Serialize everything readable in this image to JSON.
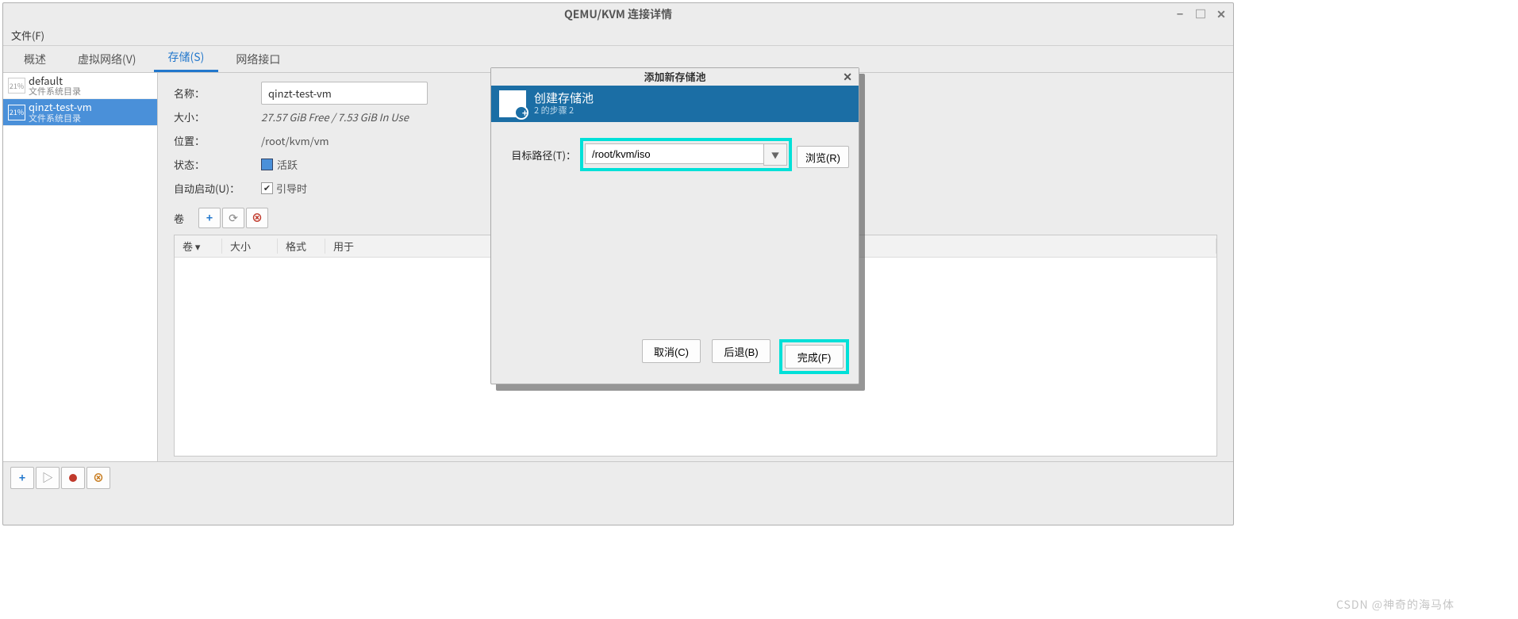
{
  "window": {
    "title": "QEMU/KVM 连接详情",
    "min": "−",
    "max": "□",
    "close": "✕"
  },
  "menubar": {
    "file": "文件(F)"
  },
  "tabs": {
    "overview": "概述",
    "vnet": "虚拟网络(V)",
    "storage": "存储(S)",
    "nic": "网络接口"
  },
  "pools": [
    {
      "pct": "21%",
      "name": "default",
      "sub": "文件系统目录",
      "selected": false
    },
    {
      "pct": "21%",
      "name": "qinzt-test-vm",
      "sub": "文件系统目录",
      "selected": true
    }
  ],
  "detail": {
    "name_lbl": "名称：",
    "name_val": "qinzt-test-vm",
    "size_lbl": "大小：",
    "size_val": "27.57 GiB Free / 7.53 GiB In Use",
    "loc_lbl": "位置：",
    "loc_val": "/root/kvm/vm",
    "state_lbl": "状态：",
    "state_val": "活跃",
    "auto_lbl": "自动启动(U)：",
    "auto_val": "引导时",
    "vol_lbl": "卷",
    "col_vol": "卷 ▾",
    "col_size": "大小",
    "col_fmt": "格式",
    "col_use": "用于"
  },
  "bottom": {
    "plus": "+",
    "play": "▶",
    "rec": "●",
    "stop": "⊗"
  },
  "dialog": {
    "title": "添加新存储池",
    "header": "创建存储池",
    "header_sub": "2 的步骤 2",
    "path_lbl": "目标路径(T)：",
    "path_val": "/root/kvm/iso",
    "browse": "浏览(R)",
    "cancel": "取消(C)",
    "back": "后退(B)",
    "finish": "完成(F)"
  },
  "watermark": "CSDN @神奇的海马体"
}
